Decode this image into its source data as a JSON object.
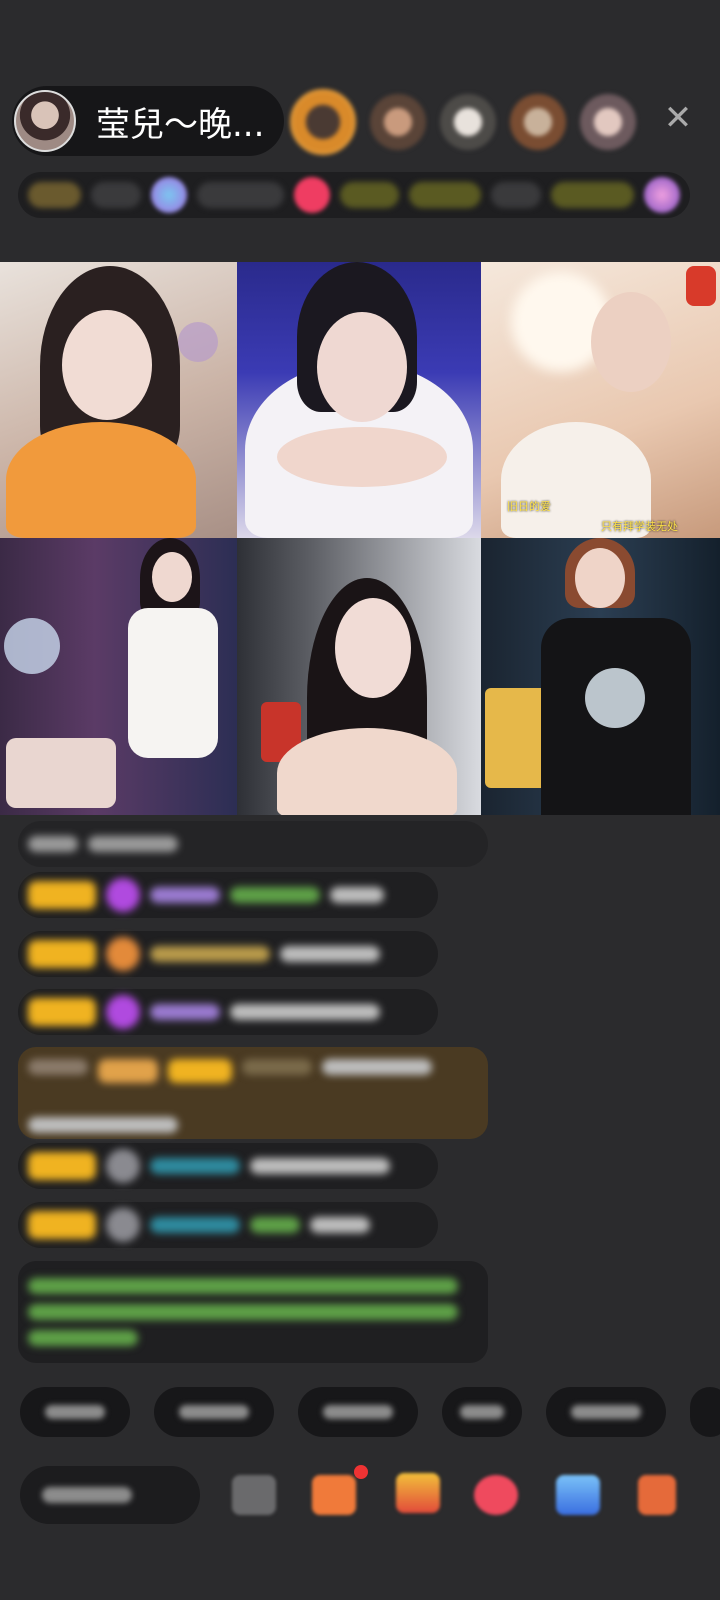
{
  "header": {
    "host_name": "莹兒～晚..."
  },
  "close_symbol": "✕",
  "video_grid": {
    "captions": [
      "旧日的爱",
      "只有拜学装无处"
    ]
  },
  "colors": {
    "background": "#2b2b2d",
    "level_badge": "#f0b321",
    "teal_name": "#2e8a9e",
    "green_text": "#5ea047"
  }
}
